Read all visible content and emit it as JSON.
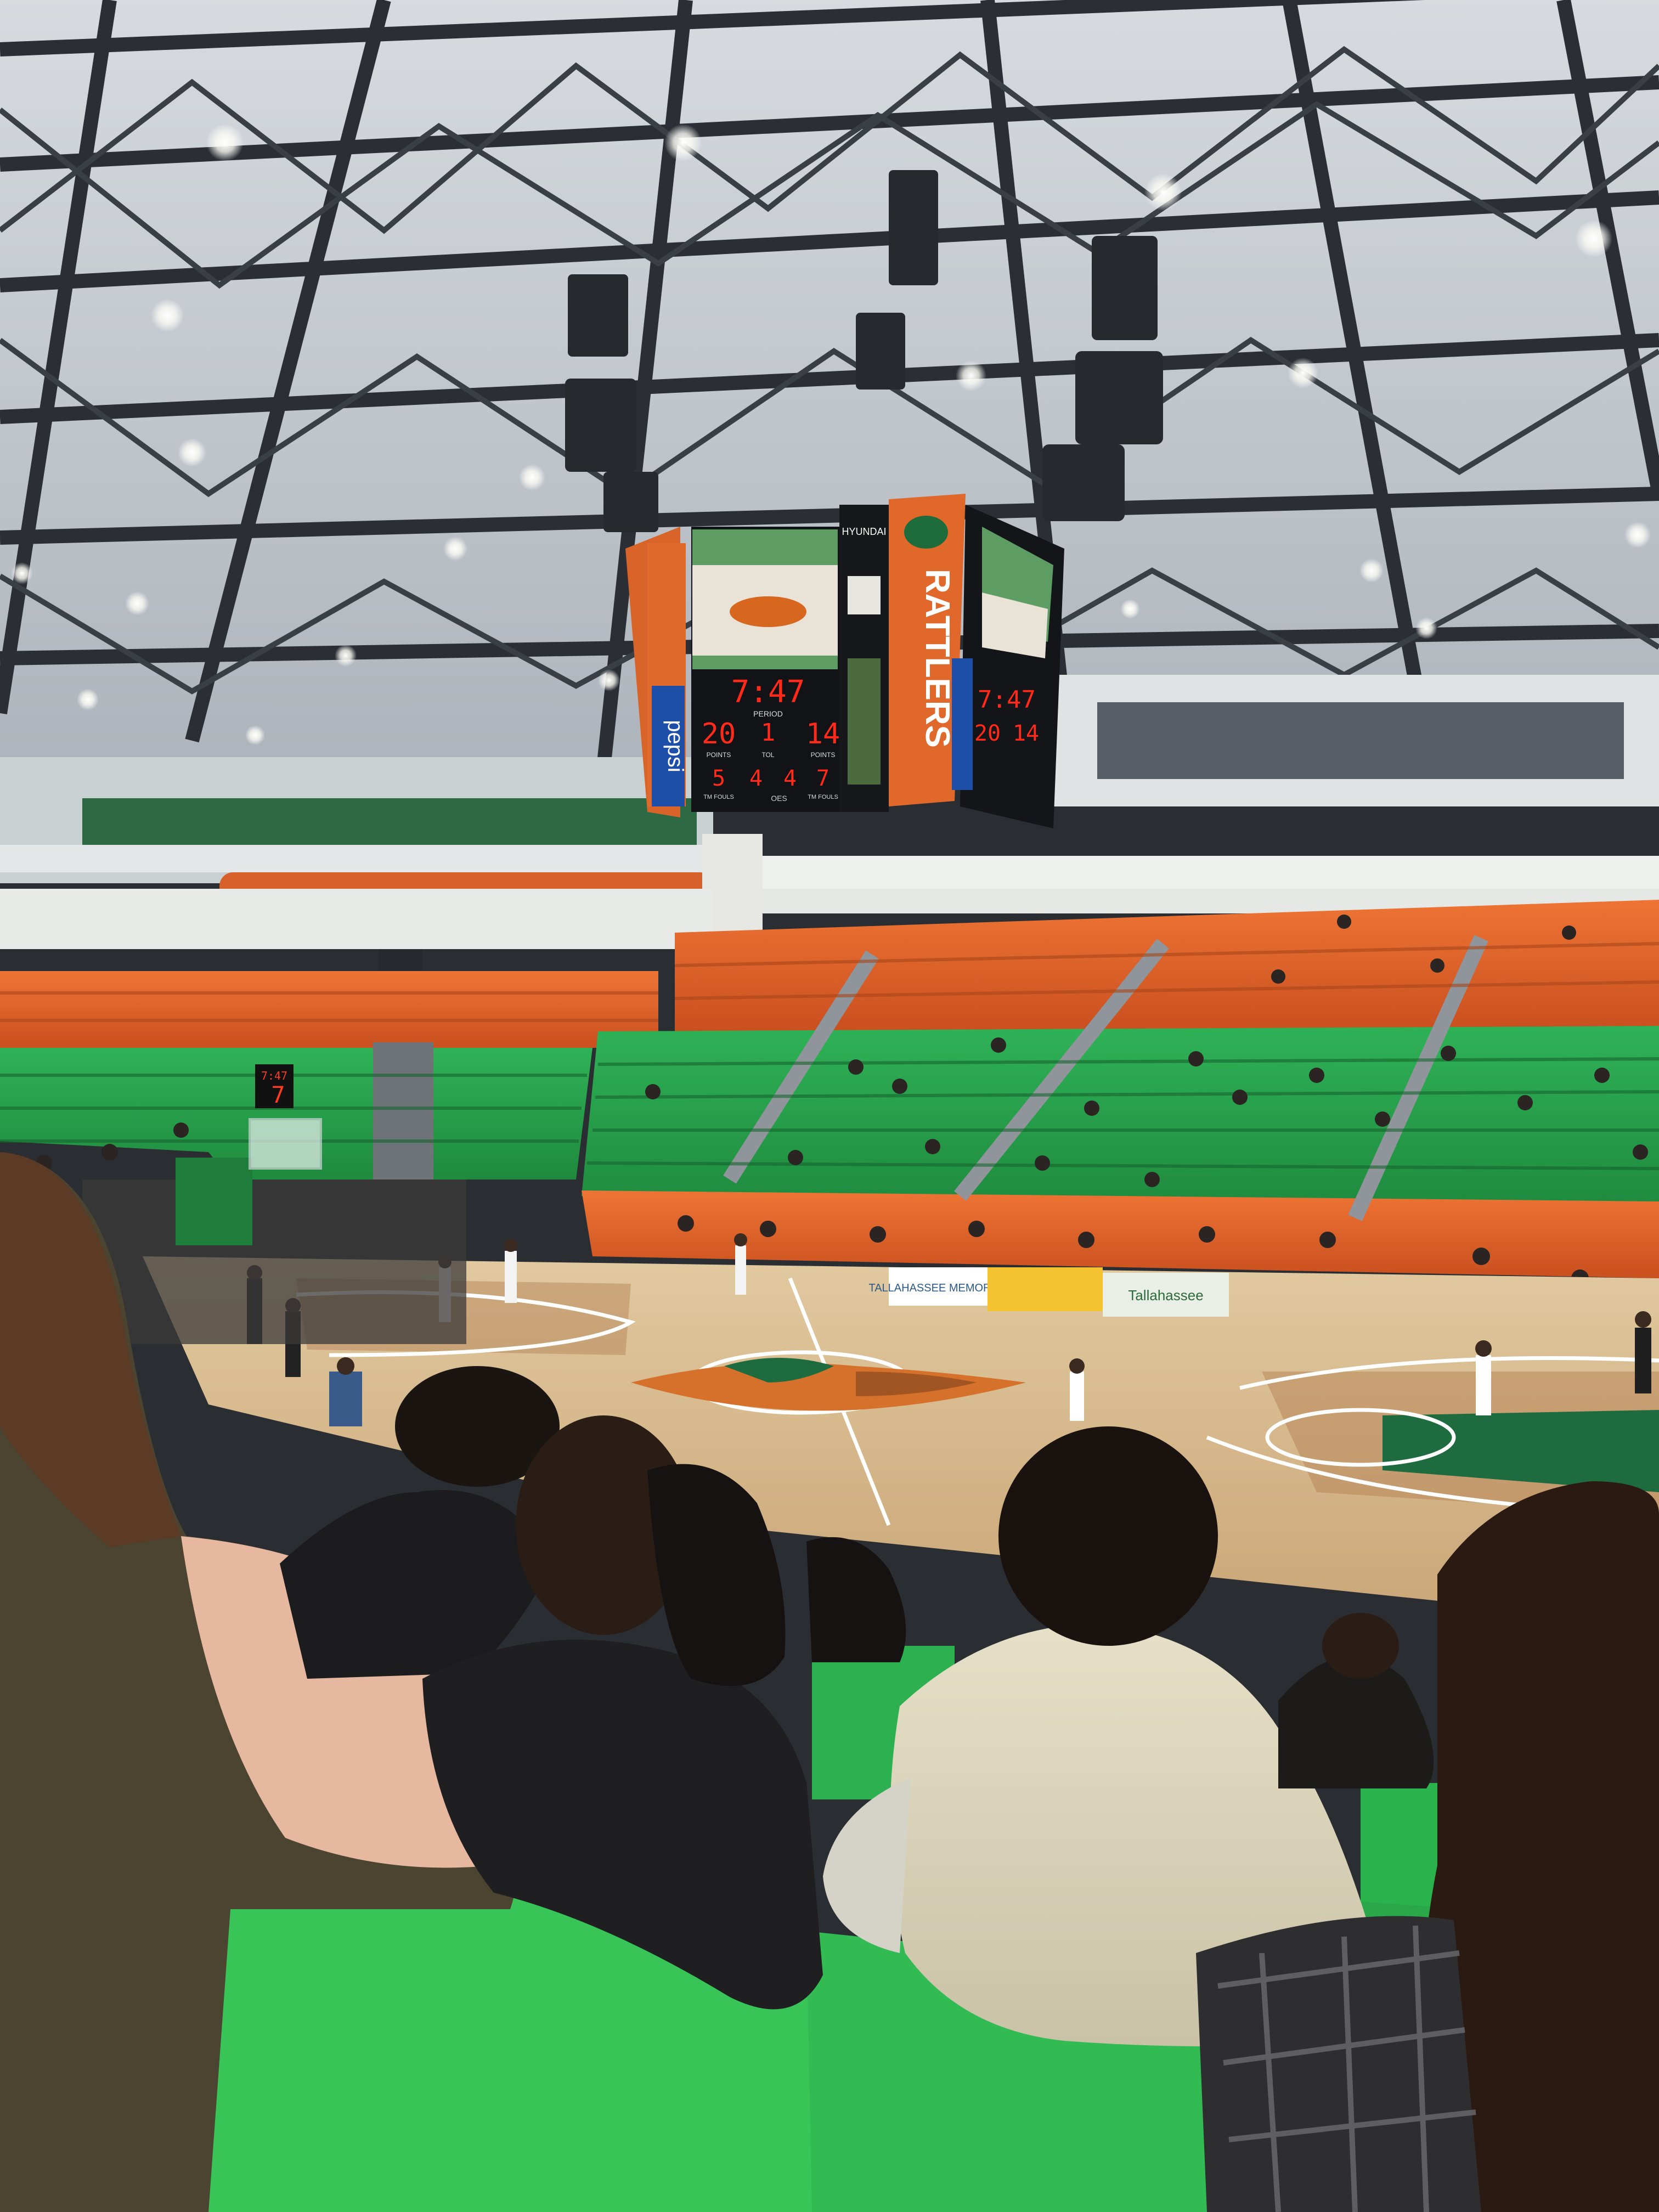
{
  "scoreboard": {
    "clock": "7:47",
    "home_score": "20",
    "away_score": "14",
    "period": "1",
    "period_label": "PERIOD",
    "points_label": "POINTS",
    "tol_label": "TOL",
    "fouls_left": "5",
    "tol_left": "4",
    "tol_right": "4",
    "fouls_right": "7",
    "tm_fouls_label": "TM FOULS",
    "team_name": "RATTLERS",
    "sponsor_top": "HYUNDAI",
    "sponsor_side": "pepsi",
    "maker": "OES"
  },
  "shot_clock": {
    "time": "7:47",
    "seconds": "7"
  },
  "court_signage": {
    "sign_left": "TALLAHASSEE MEMORIAL",
    "sign_right": "Tallahassee"
  },
  "colors": {
    "seat_green": "#2fa84f",
    "seat_orange": "#e0622a",
    "court_wood": "#d9bc8f",
    "led_red": "#ff2a1a"
  }
}
